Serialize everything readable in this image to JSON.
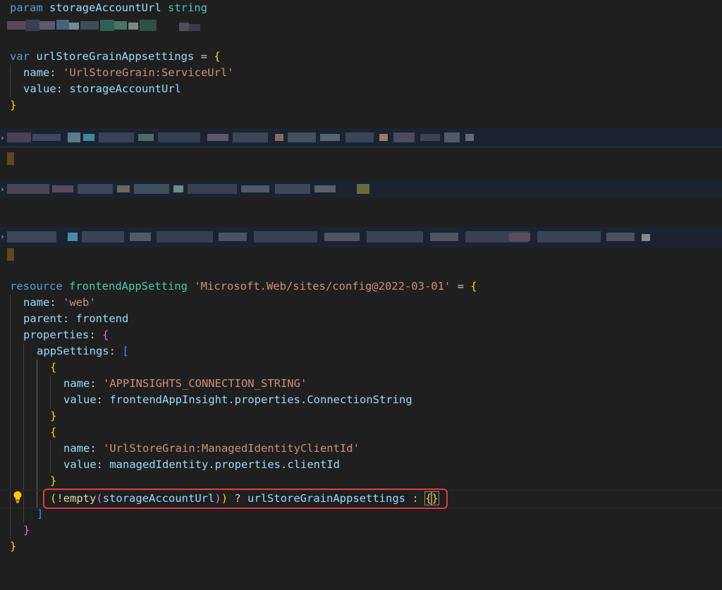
{
  "editor": {
    "language": "bicep",
    "accent_colors": {
      "keyword": "#569cd6",
      "type": "#4ec9b0",
      "identifier": "#9cdcfe",
      "string": "#ce9178",
      "function": "#dcdcaa",
      "bracket_level_1": "#ffd700",
      "bracket_level_2": "#da70d6",
      "bracket_level_3": "#179fff",
      "highlight_border": "#e23b3b"
    },
    "tokens": {
      "t_param": "param",
      "t_storageAccountUrl_decl": "storageAccountUrl",
      "t_string_type": "string",
      "t_var": "var",
      "t_urlStore_decl": "urlStoreGrainAppsettings",
      "t_eq1": " = ",
      "t_lb1": "{",
      "t_name1": "name",
      "t_colon1": ": ",
      "t_str_serviceurl": "'UrlStoreGrain:ServiceUrl'",
      "t_value1": "value",
      "t_colon2": ": ",
      "t_ref_storage1": "storageAccountUrl",
      "t_rb1": "}",
      "t_resource": "resource",
      "t_frontendAppSetting": "frontendAppSetting",
      "t_str_type": "'Microsoft.Web/sites/config@2022-03-01'",
      "t_eq2": " = ",
      "t_lb2": "{",
      "t_name2": "name",
      "t_colon3": ": ",
      "t_str_web": "'web'",
      "t_parent": "parent",
      "t_colon4": ": ",
      "t_frontend": "frontend",
      "t_properties": "properties",
      "t_colon5": ": ",
      "t_lb3": "{",
      "t_appSettings": "appSettings",
      "t_colon6": ": ",
      "t_lsq": "[",
      "t_lb4": "{",
      "t_name3": "name",
      "t_colon7": ": ",
      "t_str_appinsights": "'APPINSIGHTS_CONNECTION_STRING'",
      "t_value2": "value",
      "t_colon8": ": ",
      "t_frontendAppInsight": "frontendAppInsight",
      "t_dot1": ".",
      "t_properties2": "properties",
      "t_dot2": ".",
      "t_ConnectionString": "ConnectionString",
      "t_rb4": "}",
      "t_lb5": "{",
      "t_name4": "name",
      "t_colon9": ": ",
      "t_str_managedid": "'UrlStoreGrain:ManagedIdentityClientId'",
      "t_value3": "value",
      "t_colon10": ": ",
      "t_managedIdentity": "managedIdentity",
      "t_dot3": ".",
      "t_properties3": "properties",
      "t_dot4": ".",
      "t_clientId": "clientId",
      "t_rb5": "}",
      "t_lp1": "(",
      "t_bang": "!",
      "t_empty": "empty",
      "t_lp2": "(",
      "t_ref_storage2": "storageAccountUrl",
      "t_rp2": ")",
      "t_rp1": ")",
      "t_ternary_q": " ? ",
      "t_ref_urlStore": "urlStoreGrainAppsettings",
      "t_ternary_c": " : ",
      "t_empty_lb": "{",
      "t_empty_rb": "}",
      "t_rsq": "]",
      "t_rb3": "}",
      "t_rb2": "}"
    }
  }
}
